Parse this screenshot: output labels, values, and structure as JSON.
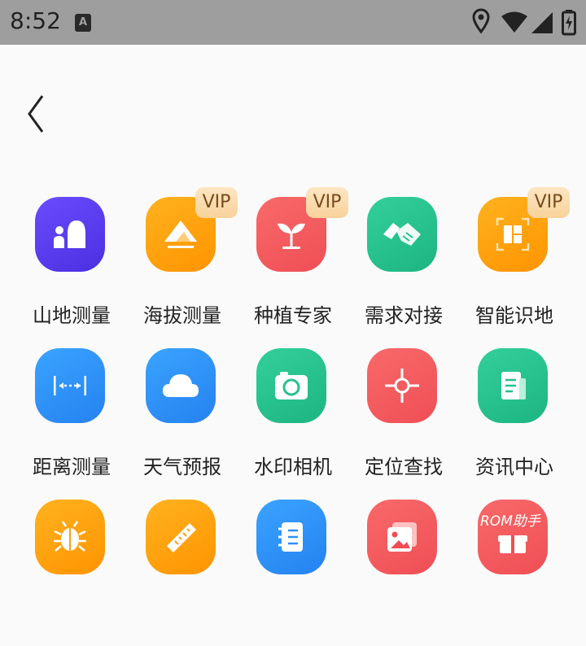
{
  "status_bar": {
    "time": "8:52",
    "notification_letter": "A"
  },
  "grid": {
    "vip_label": "VIP",
    "items": [
      {
        "label": "山地测量",
        "icon": "mountain-people-icon",
        "vip": false
      },
      {
        "label": "海拔测量",
        "icon": "mountain-altitude-icon",
        "vip": true
      },
      {
        "label": "种植专家",
        "icon": "sprout-icon",
        "vip": true
      },
      {
        "label": "需求对接",
        "icon": "handshake-icon",
        "vip": false
      },
      {
        "label": "智能识地",
        "icon": "land-scan-icon",
        "vip": true
      },
      {
        "label": "距离测量",
        "icon": "distance-ruler-icon",
        "vip": false
      },
      {
        "label": "天气预报",
        "icon": "cloud-icon",
        "vip": false
      },
      {
        "label": "水印相机",
        "icon": "camera-icon",
        "vip": false
      },
      {
        "label": "定位查找",
        "icon": "crosshair-icon",
        "vip": false
      },
      {
        "label": "资讯中心",
        "icon": "news-icon",
        "vip": false
      },
      {
        "label": "",
        "icon": "bug-icon",
        "vip": false
      },
      {
        "label": "",
        "icon": "ruler-icon",
        "vip": false
      },
      {
        "label": "",
        "icon": "notebook-icon",
        "vip": false
      },
      {
        "label": "",
        "icon": "photo-gallery-icon",
        "vip": false
      },
      {
        "label": "",
        "icon": "gift-icon",
        "vip": false
      }
    ]
  },
  "watermark": "ROM助手",
  "colors": {
    "purple": "#5b3cf0",
    "orange": "#ff9f0f",
    "red": "#f0515a",
    "green": "#25c18c",
    "blue": "#2f8ff5"
  }
}
